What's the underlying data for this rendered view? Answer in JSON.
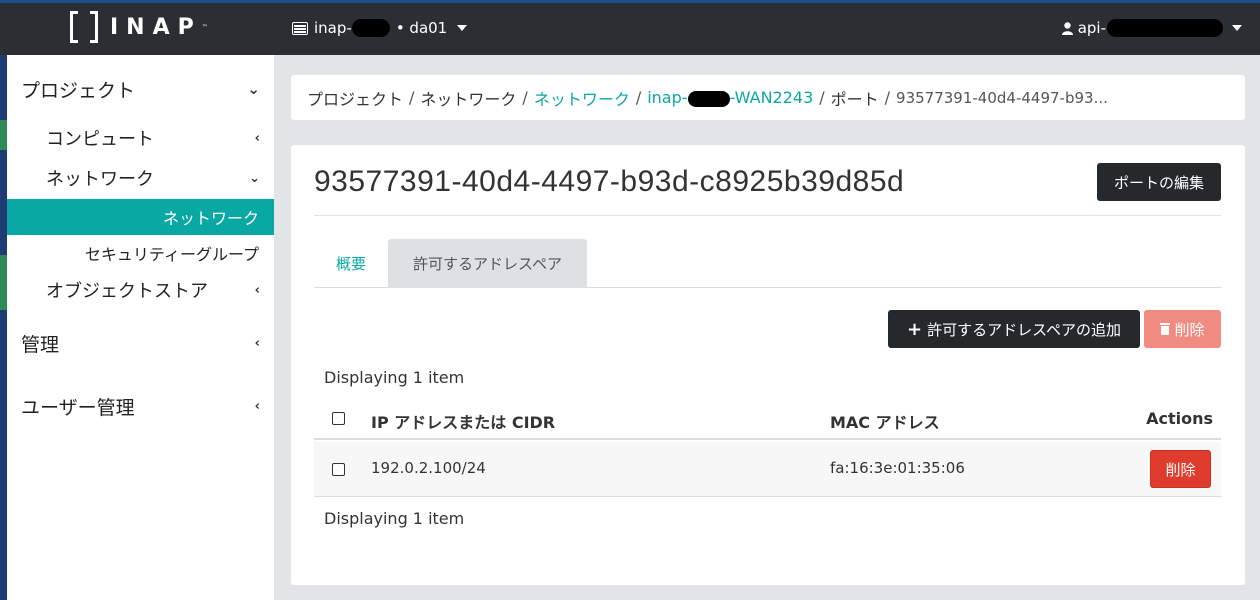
{
  "topbar": {
    "logo_text": "INAP",
    "logo_tm": "™",
    "project_prefix": "inap-",
    "project_suffix": "• da01",
    "user_prefix": "api-"
  },
  "sidebar": {
    "items": [
      {
        "label": "プロジェクト",
        "chevron": "⌄"
      },
      {
        "label": "コンピュート",
        "chevron": "‹"
      },
      {
        "label": "ネットワーク",
        "chevron": "⌄"
      },
      {
        "label": "ネットワーク"
      },
      {
        "label": "セキュリティーグループ"
      },
      {
        "label": "オブジェクトストア",
        "chevron": "‹"
      },
      {
        "label": "管理",
        "chevron": "‹"
      },
      {
        "label": "ユーザー管理",
        "chevron": "‹"
      }
    ]
  },
  "breadcrumb": {
    "items": [
      "プロジェクト",
      "ネットワーク",
      "ネットワーク",
      "inap-",
      "-WAN2243",
      "ポート",
      "93577391-40d4-4497-b93..."
    ],
    "separator": "/"
  },
  "page": {
    "title": "93577391-40d4-4497-b93d-c8925b39d85d",
    "edit_port_label": "ポートの編集"
  },
  "tabs": [
    {
      "label": "概要"
    },
    {
      "label": "許可するアドレスペア"
    }
  ],
  "actions": {
    "add_label": "許可するアドレスペアの追加",
    "delete_label": "削除"
  },
  "table": {
    "count_top": "Displaying 1 item",
    "count_bottom": "Displaying 1 item",
    "columns": [
      "IP アドレスまたは CIDR",
      "MAC アドレス",
      "Actions"
    ],
    "rows": [
      {
        "ip": "192.0.2.100/24",
        "mac": "fa:16:3e:01:35:06",
        "action": "削除"
      }
    ]
  },
  "colors": {
    "accent": "#0aa8a3",
    "topbar": "#2b2f33",
    "danger": "#e03c2d",
    "danger_disabled": "#ef8b80"
  }
}
